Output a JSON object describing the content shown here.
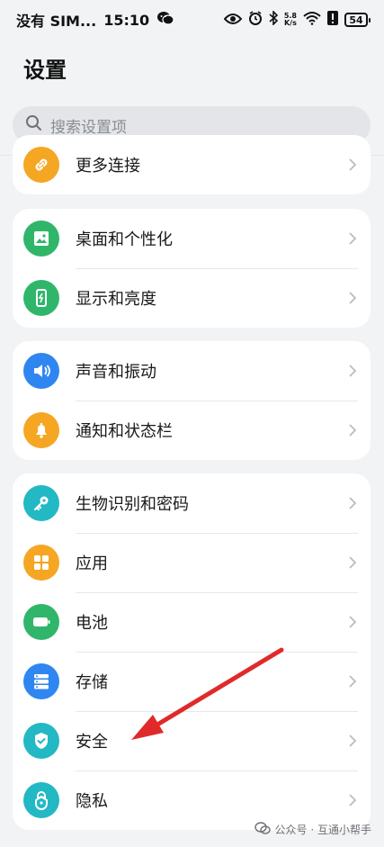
{
  "status_bar": {
    "carrier": "没有 SIM...",
    "time": "15:10",
    "speed_top": "5.8",
    "speed_unit": "K/s",
    "battery": "54"
  },
  "page": {
    "title": "设置"
  },
  "search": {
    "placeholder": "搜索设置项"
  },
  "groups": [
    {
      "items": [
        {
          "label": "更多连接",
          "icon": "link-icon",
          "color": "#f5a623"
        }
      ]
    },
    {
      "items": [
        {
          "label": "桌面和个性化",
          "icon": "image-icon",
          "color": "#2fb66a"
        },
        {
          "label": "显示和亮度",
          "icon": "phone-brightness-icon",
          "color": "#2fb66a"
        }
      ]
    },
    {
      "items": [
        {
          "label": "声音和振动",
          "icon": "speaker-icon",
          "color": "#2f86f0"
        },
        {
          "label": "通知和状态栏",
          "icon": "bell-icon",
          "color": "#f5a623"
        }
      ]
    },
    {
      "items": [
        {
          "label": "生物识别和密码",
          "icon": "key-icon",
          "color": "#22b8c4"
        },
        {
          "label": "应用",
          "icon": "apps-grid-icon",
          "color": "#f5a623"
        },
        {
          "label": "电池",
          "icon": "battery-icon",
          "color": "#2fb66a"
        },
        {
          "label": "存储",
          "icon": "storage-icon",
          "color": "#2f86f0"
        },
        {
          "label": "安全",
          "icon": "shield-icon",
          "color": "#22b8c4"
        },
        {
          "label": "隐私",
          "icon": "privacy-lock-icon",
          "color": "#22b8c4"
        }
      ]
    }
  ],
  "watermark": {
    "text": "公众号 · 互通小帮手"
  },
  "annotation": {
    "color": "#e02a2a"
  }
}
